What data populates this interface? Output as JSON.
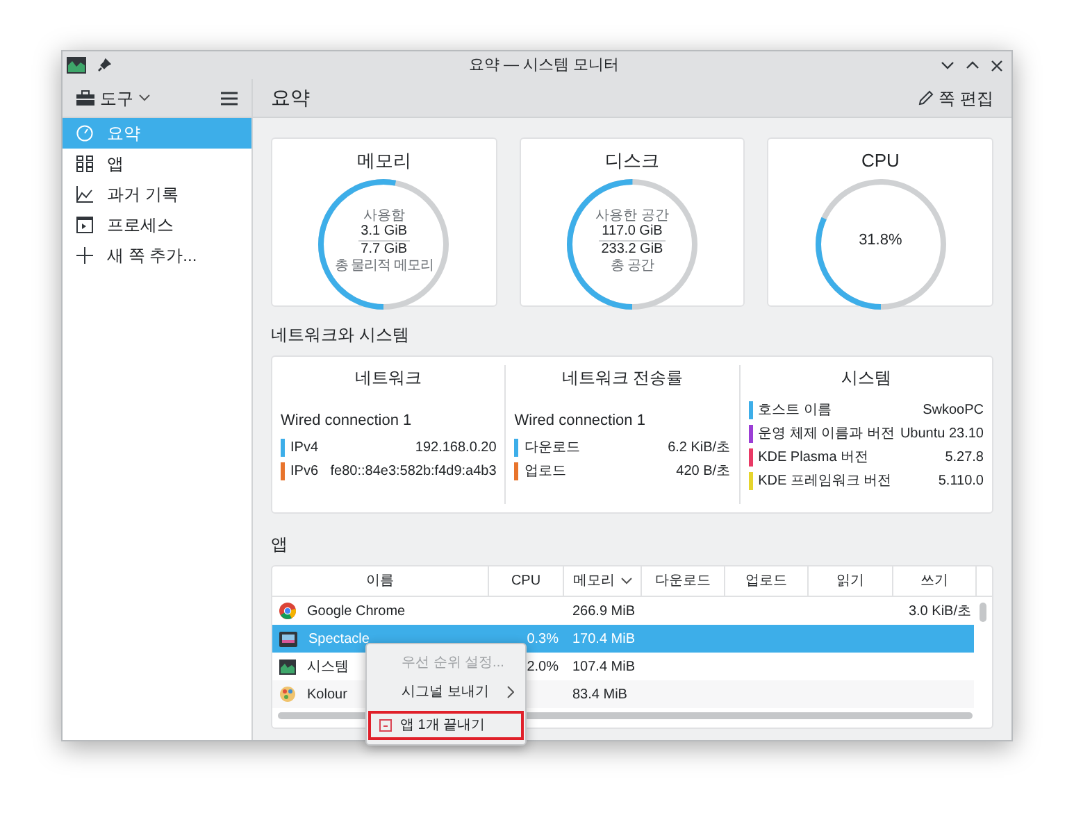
{
  "window": {
    "title": "요약 — 시스템 모니터"
  },
  "toolbar": {
    "tools_label": "도구",
    "page_title": "요약",
    "edit_button": "쪽 편집"
  },
  "sidebar": {
    "items": [
      {
        "label": "요약",
        "kind": "summary",
        "selected": true
      },
      {
        "label": "앱",
        "kind": "apps",
        "selected": false
      },
      {
        "label": "과거 기록",
        "kind": "history",
        "selected": false
      },
      {
        "label": "프로세스",
        "kind": "processes",
        "selected": false
      },
      {
        "label": "새 쪽 추가...",
        "kind": "add",
        "selected": false
      }
    ]
  },
  "cards": [
    {
      "kind": "ratio",
      "title": "메모리",
      "label_top": "사용함",
      "used": "3.1 GiB",
      "total": "7.7 GiB",
      "label_bottom": "총 물리적 메모리",
      "level": 0.53
    },
    {
      "kind": "ratio",
      "title": "디스크",
      "label_top": "사용한 공간",
      "used": "117.0 GiB",
      "total": "233.2 GiB",
      "label_bottom": "총 공간",
      "level": 0.5
    },
    {
      "kind": "percent",
      "title": "CPU",
      "value": "31.8%",
      "level": 0.318
    }
  ],
  "network_section": {
    "title": "네트워크와 시스템",
    "panels": [
      {
        "title": "네트워크",
        "subtitle": "Wired connection 1",
        "rows": [
          {
            "label": "IPv4",
            "value": "192.168.0.20",
            "color": "#3daee9"
          },
          {
            "label": "IPv6",
            "value": "fe80::84e3:582b:f4d9:a4b3",
            "color": "#e8742c"
          }
        ]
      },
      {
        "title": "네트워크 전송률",
        "subtitle": "Wired connection 1",
        "rows": [
          {
            "label": "다운로드",
            "value": "6.2 KiB/초",
            "color": "#3daee9"
          },
          {
            "label": "업로드",
            "value": "420 B/초",
            "color": "#e8742c"
          }
        ]
      },
      {
        "title": "시스템",
        "rows": [
          {
            "label": "호스트 이름",
            "value": "SwkooPC",
            "color": "#3daee9"
          },
          {
            "label": "운영 체제 이름과 버전",
            "value": "Ubuntu 23.10",
            "color": "#9b3ed5"
          },
          {
            "label": "KDE Plasma 버전",
            "value": "5.27.8",
            "color": "#e93a66"
          },
          {
            "label": "KDE 프레임워크 버전",
            "value": "5.110.0",
            "color": "#e6d52d"
          }
        ]
      }
    ]
  },
  "apps_section": {
    "title": "앱",
    "columns": [
      {
        "label": "이름",
        "sorted": false
      },
      {
        "label": "CPU",
        "sorted": false
      },
      {
        "label": "메모리",
        "sorted": true
      },
      {
        "label": "다운로드",
        "sorted": false
      },
      {
        "label": "업로드",
        "sorted": false
      },
      {
        "label": "읽기",
        "sorted": false
      },
      {
        "label": "쓰기",
        "sorted": false
      }
    ],
    "rows": [
      {
        "kind": "chrome",
        "selected": false,
        "cells": [
          "Google Chrome",
          "",
          "266.9 MiB",
          "",
          "",
          "",
          "3.0 KiB/초"
        ]
      },
      {
        "kind": "screenshot",
        "selected": true,
        "cells": [
          "Spectacle",
          "0.3%",
          "170.4 MiB",
          "",
          "",
          "",
          ""
        ]
      },
      {
        "kind": "monitor",
        "selected": false,
        "cells": [
          "시스템",
          "2.0%",
          "107.4 MiB",
          "",
          "",
          "",
          ""
        ]
      },
      {
        "kind": "palette",
        "selected": false,
        "cells": [
          "Kolour",
          "",
          "83.4 MiB",
          "",
          "",
          "",
          ""
        ]
      }
    ],
    "context_menu": [
      {
        "label": "우선 순위 설정...",
        "disabled": true,
        "submenu": false,
        "highlighted": false
      },
      {
        "label": "시그널 보내기",
        "disabled": false,
        "submenu": true,
        "highlighted": false
      },
      {
        "label": "앱 1개 끝내기",
        "disabled": false,
        "submenu": false,
        "highlighted": true,
        "kind": "quit"
      }
    ]
  }
}
